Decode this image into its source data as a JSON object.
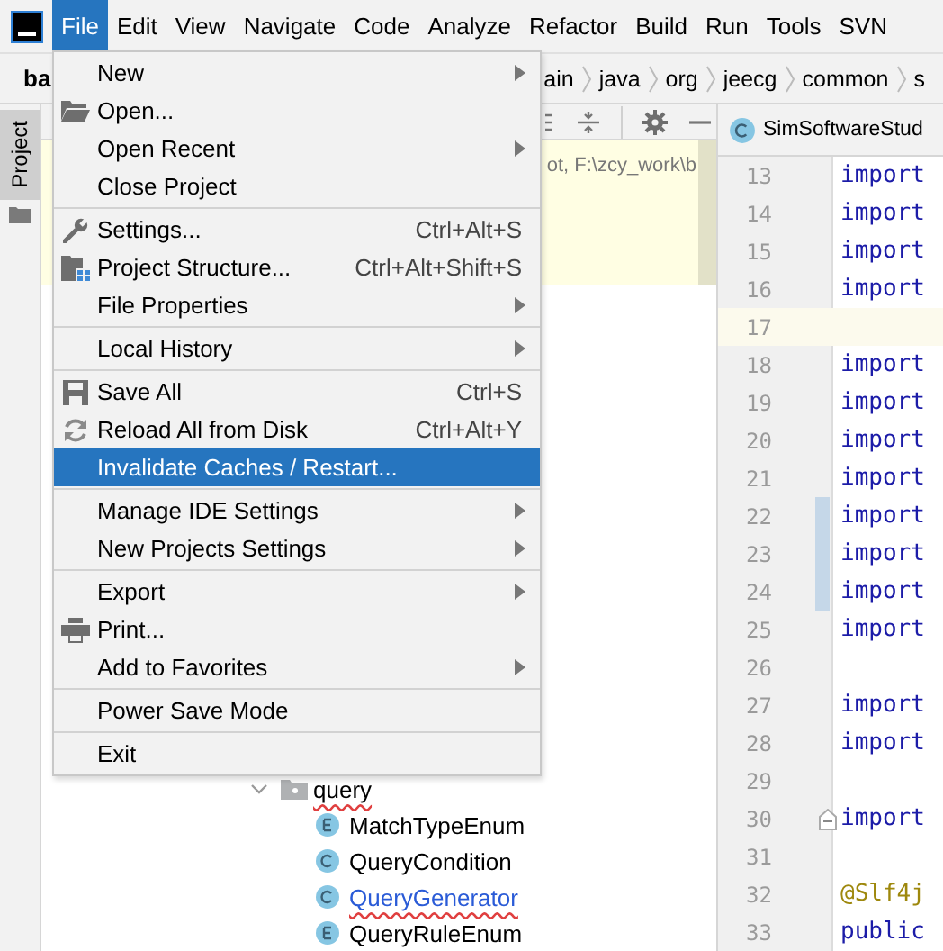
{
  "menubar": {
    "items": [
      {
        "label": "File",
        "selected": true
      },
      {
        "label": "Edit",
        "selected": false
      },
      {
        "label": "View",
        "selected": false
      },
      {
        "label": "Navigate",
        "selected": false
      },
      {
        "label": "Code",
        "selected": false
      },
      {
        "label": "Analyze",
        "selected": false
      },
      {
        "label": "Refactor",
        "selected": false
      },
      {
        "label": "Build",
        "selected": false
      },
      {
        "label": "Run",
        "selected": false
      },
      {
        "label": "Tools",
        "selected": false
      },
      {
        "label": "SVN",
        "selected": false
      }
    ]
  },
  "breadcrumb": {
    "project": "ba",
    "crumbs": [
      "ain",
      "java",
      "org",
      "jeecg",
      "common",
      "s"
    ]
  },
  "tool_window_stripe": {
    "tabs": [
      {
        "label": "Project",
        "selected": true
      }
    ]
  },
  "project_panel": {
    "notice": "ot,  F:\\zcy_work\\b",
    "tree": [
      {
        "label": "query",
        "kind": "package",
        "expanded": true,
        "typo": true,
        "modified": false,
        "children": [
          {
            "label": "MatchTypeEnum",
            "kind": "enum",
            "typo": false,
            "modified": false
          },
          {
            "label": "QueryCondition",
            "kind": "class",
            "typo": false,
            "modified": false
          },
          {
            "label": "QueryGenerator",
            "kind": "class",
            "typo": true,
            "modified": true
          },
          {
            "label": "QueryRuleEnum",
            "kind": "enum",
            "typo": false,
            "modified": false
          }
        ]
      }
    ]
  },
  "editor": {
    "tab": {
      "label": "SimSoftwareStud",
      "kind": "class"
    },
    "lines": [
      {
        "number": "13",
        "code": "import",
        "kind": "keyword",
        "current": false,
        "changed": false
      },
      {
        "number": "14",
        "code": "import",
        "kind": "keyword",
        "current": false,
        "changed": false
      },
      {
        "number": "15",
        "code": "import",
        "kind": "keyword",
        "current": false,
        "changed": false
      },
      {
        "number": "16",
        "code": "import",
        "kind": "keyword",
        "current": false,
        "changed": false
      },
      {
        "number": "17",
        "kind": "blank",
        "current": true,
        "changed": false
      },
      {
        "number": "18",
        "code": "import",
        "kind": "keyword",
        "current": false,
        "changed": false
      },
      {
        "number": "19",
        "code": "import",
        "kind": "keyword",
        "current": false,
        "changed": false
      },
      {
        "number": "20",
        "code": "import",
        "kind": "keyword",
        "current": false,
        "changed": false
      },
      {
        "number": "21",
        "code": "import",
        "kind": "keyword",
        "current": false,
        "changed": false
      },
      {
        "number": "22",
        "code": "import",
        "kind": "keyword",
        "current": false,
        "changed": true
      },
      {
        "number": "23",
        "code": "import",
        "kind": "keyword",
        "current": false,
        "changed": true
      },
      {
        "number": "24",
        "code": "import",
        "kind": "keyword",
        "current": false,
        "changed": true
      },
      {
        "number": "25",
        "code": "import",
        "kind": "keyword",
        "current": false,
        "changed": false
      },
      {
        "number": "26",
        "kind": "blank",
        "current": false,
        "changed": false
      },
      {
        "number": "27",
        "code": "import",
        "kind": "keyword",
        "current": false,
        "changed": false
      },
      {
        "number": "28",
        "code": "import",
        "kind": "keyword",
        "current": false,
        "changed": false
      },
      {
        "number": "29",
        "kind": "blank",
        "current": false,
        "changed": false
      },
      {
        "number": "30",
        "code": "import",
        "kind": "keyword",
        "current": false,
        "changed": false,
        "foldable": true
      },
      {
        "number": "31",
        "kind": "blank",
        "current": false,
        "changed": false
      },
      {
        "number": "32",
        "code": "@Slf4j",
        "kind": "annotation",
        "current": false,
        "changed": false
      },
      {
        "number": "33",
        "code": "public",
        "kind": "keyword",
        "current": false,
        "changed": false
      }
    ]
  },
  "file_menu": {
    "items": [
      {
        "kind": "item",
        "label": "New",
        "submenu": true,
        "selected": false
      },
      {
        "kind": "item",
        "label": "Open...",
        "submenu": false,
        "selected": false
      },
      {
        "kind": "item",
        "label": "Open Recent",
        "submenu": true,
        "selected": false
      },
      {
        "kind": "item",
        "label": "Close Project",
        "submenu": false,
        "selected": false
      },
      {
        "kind": "separator"
      },
      {
        "kind": "item",
        "label": "Settings...",
        "shortcut": "Ctrl+Alt+S",
        "submenu": false,
        "selected": false
      },
      {
        "kind": "item",
        "label": "Project Structure...",
        "shortcut": "Ctrl+Alt+Shift+S",
        "submenu": false,
        "selected": false
      },
      {
        "kind": "item",
        "label": "File Properties",
        "submenu": true,
        "selected": false
      },
      {
        "kind": "separator"
      },
      {
        "kind": "item",
        "label": "Local History",
        "submenu": true,
        "selected": false
      },
      {
        "kind": "separator"
      },
      {
        "kind": "item",
        "label": "Save All",
        "shortcut": "Ctrl+S",
        "submenu": false,
        "selected": false
      },
      {
        "kind": "item",
        "label": "Reload All from Disk",
        "shortcut": "Ctrl+Alt+Y",
        "submenu": false,
        "selected": false
      },
      {
        "kind": "item",
        "label": "Invalidate Caches / Restart...",
        "submenu": false,
        "selected": true
      },
      {
        "kind": "separator"
      },
      {
        "kind": "item",
        "label": "Manage IDE Settings",
        "submenu": true,
        "selected": false
      },
      {
        "kind": "item",
        "label": "New Projects Settings",
        "submenu": true,
        "selected": false
      },
      {
        "kind": "separator"
      },
      {
        "kind": "item",
        "label": "Export",
        "submenu": true,
        "selected": false
      },
      {
        "kind": "item",
        "label": "Print...",
        "submenu": false,
        "selected": false
      },
      {
        "kind": "item",
        "label": "Add to Favorites",
        "submenu": true,
        "selected": false
      },
      {
        "kind": "separator"
      },
      {
        "kind": "item",
        "label": "Power Save Mode",
        "submenu": false,
        "selected": false
      },
      {
        "kind": "separator"
      },
      {
        "kind": "item",
        "label": "Exit",
        "submenu": false,
        "selected": false
      }
    ]
  }
}
